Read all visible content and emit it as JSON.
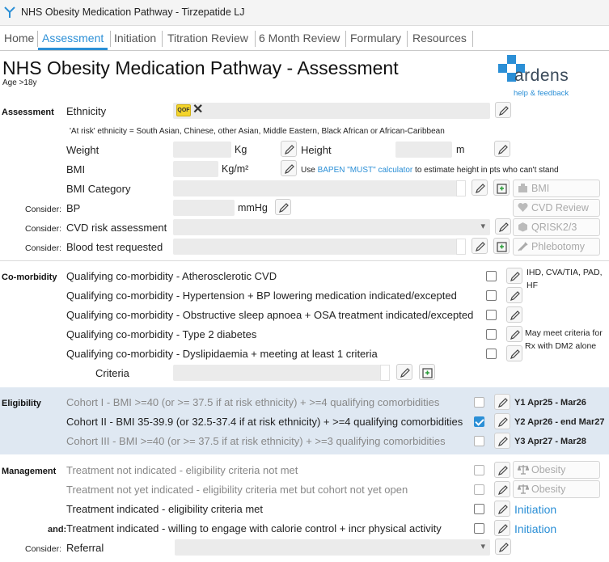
{
  "window": {
    "title": "NHS Obesity Medication Pathway -  Tirzepatide LJ"
  },
  "tabs": [
    "Home",
    "Assessment",
    "Initiation",
    "Titration Review",
    "6 Month Review",
    "Formulary",
    "Resources"
  ],
  "header": {
    "title": "NHS Obesity Medication Pathway - Assessment",
    "subtitle": "Age >18y",
    "brand": "ardens",
    "help": "help & feedback"
  },
  "assessment": {
    "section": "Assessment",
    "ethnicity_label": "Ethnicity",
    "qof_badge": "QOF",
    "at_risk_note": "'At risk' ethnicity = South Asian, Chinese, other Asian, Middle Eastern, Black African or African-Caribbean",
    "weight_label": "Weight",
    "weight_unit": "Kg",
    "height_label": "Height",
    "height_unit": "m",
    "bmi_label": "BMI",
    "bmi_unit": "Kg/m²",
    "bapen_pre": "Use",
    "bapen_link": "BAPEN \"MUST\" calculator",
    "bapen_post": "to estimate height in pts who can't stand",
    "bmi_category_label": "BMI Category",
    "consider": "Consider:",
    "bp_label": "BP",
    "bp_unit": "mmHg",
    "cvd_label": "CVD risk assessment",
    "blood_label": "Blood test requested",
    "btn_bmi": "BMI",
    "btn_cvd": "CVD Review",
    "btn_qrisk": "QRISK2/3",
    "btn_phleb": "Phlebotomy"
  },
  "comorbidity": {
    "section": "Co-morbidity",
    "items": [
      "Qualifying co-morbidity - Atherosclerotic CVD",
      "Qualifying co-morbidity - Hypertension + BP lowering medication indicated/excepted",
      "Qualifying co-morbidity - Obstructive sleep apnoea + OSA treatment indicated/excepted",
      "Qualifying co-morbidity - Type 2 diabetes",
      "Qualifying co-morbidity - Dyslipidaemia + meeting at least 1 criteria"
    ],
    "criteria_label": "Criteria",
    "note1": "IHD, CVA/TIA, PAD, HF",
    "note2": "May meet criteria for Rx with DM2 alone"
  },
  "eligibility": {
    "section": "Eligibility",
    "items": [
      {
        "label": "Cohort I - BMI >=40 (or >= 37.5 if at risk ethnicity) + >=4 qualifying comorbidities",
        "date": "Y1 Apr25 - Mar26",
        "checked": false
      },
      {
        "label": "Cohort II - BMI 35-39.9 (or 32.5-37.4 if at risk ethnicity) + >=4 qualifying comorbidities",
        "date": "Y2 Apr26 - end Mar27",
        "checked": true
      },
      {
        "label": "Cohort III - BMI >=40 (or >= 37.5 if at risk ethnicity) + >=3 qualifying comorbidities",
        "date": "Y3 Apr27 - Mar28",
        "checked": false
      }
    ]
  },
  "management": {
    "section": "Management",
    "items": [
      "Treatment not indicated - eligibility criteria not met",
      "Treatment not yet indicated - eligibility criteria met but cohort not yet open",
      "Treatment indicated - eligibility criteria met",
      "Treatment indicated - willing to engage with calorie control + incr physical activity"
    ],
    "and_label": "and:",
    "consider": "Consider:",
    "referral_label": "Referral",
    "btn_obesity": "Obesity",
    "link_initiation": "Initiation"
  }
}
